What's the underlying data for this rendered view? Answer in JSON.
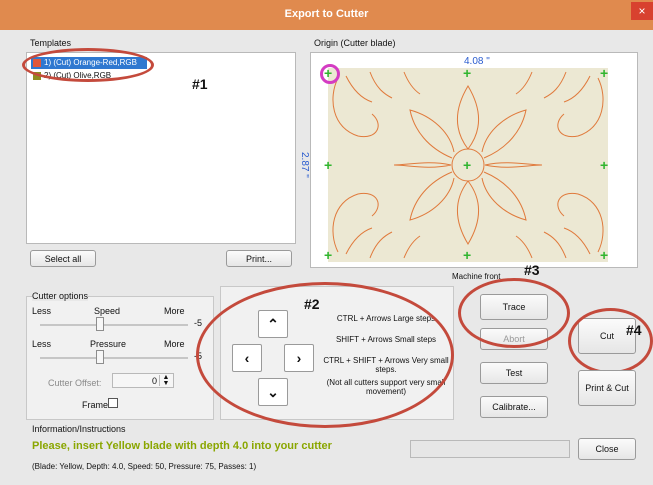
{
  "window": {
    "title": "Export to Cutter",
    "close_glyph": "×"
  },
  "templates": {
    "label": "Templates",
    "items": [
      {
        "label": "1) (Cut) Orange-Red,RGB",
        "color": "#e0573a"
      },
      {
        "label": "2) (Cut) Olive,RGB",
        "color": "#8f8c20"
      }
    ],
    "select_all": "Select all",
    "print": "Print..."
  },
  "origin": {
    "label": "Origin (Cutter blade)",
    "width": "4.08 \"",
    "height": "2.87 \"",
    "machine_front": "Machine front",
    "plus_glyph": "+"
  },
  "cutter_options": {
    "label": "Cutter options",
    "speed": {
      "less": "Less",
      "name": "Speed",
      "more": "More",
      "value": "-5"
    },
    "pressure": {
      "less": "Less",
      "name": "Pressure",
      "more": "More",
      "value": "-5"
    },
    "offset_label": "Cutter Offset:",
    "offset_value": "0",
    "frame_label": "Frame"
  },
  "arrows": {
    "up": "⌃",
    "down": "⌄",
    "left": "‹",
    "right": "›",
    "hints": [
      "CTRL + Arrows  Large steps",
      "SHIFT + Arrows  Small steps",
      "CTRL + SHIFT + Arrows  Very small steps.",
      "(Not all cutters support very small movement)"
    ]
  },
  "buttons": {
    "trace": "Trace",
    "abort": "Abort",
    "test": "Test",
    "calibrate": "Calibrate...",
    "cut": "Cut",
    "print_cut": "Print & Cut",
    "close": "Close"
  },
  "info": {
    "label": "Information/Instructions",
    "main": "Please, insert Yellow blade with depth 4.0 into your cutter",
    "detail": "(Blade: Yellow,  Depth: 4.0, Speed: 50, Pressure: 75, Passes: 1)"
  },
  "annotations": {
    "a1": "#1",
    "a2": "#2",
    "a3": "#3",
    "a4": "#4"
  },
  "colors": {
    "accent": "#e08a4e",
    "oval": "#c44a3c",
    "design_stroke": "#e07a3c",
    "canvas_bg": "#ece8d3",
    "info_text": "#8aa600"
  }
}
